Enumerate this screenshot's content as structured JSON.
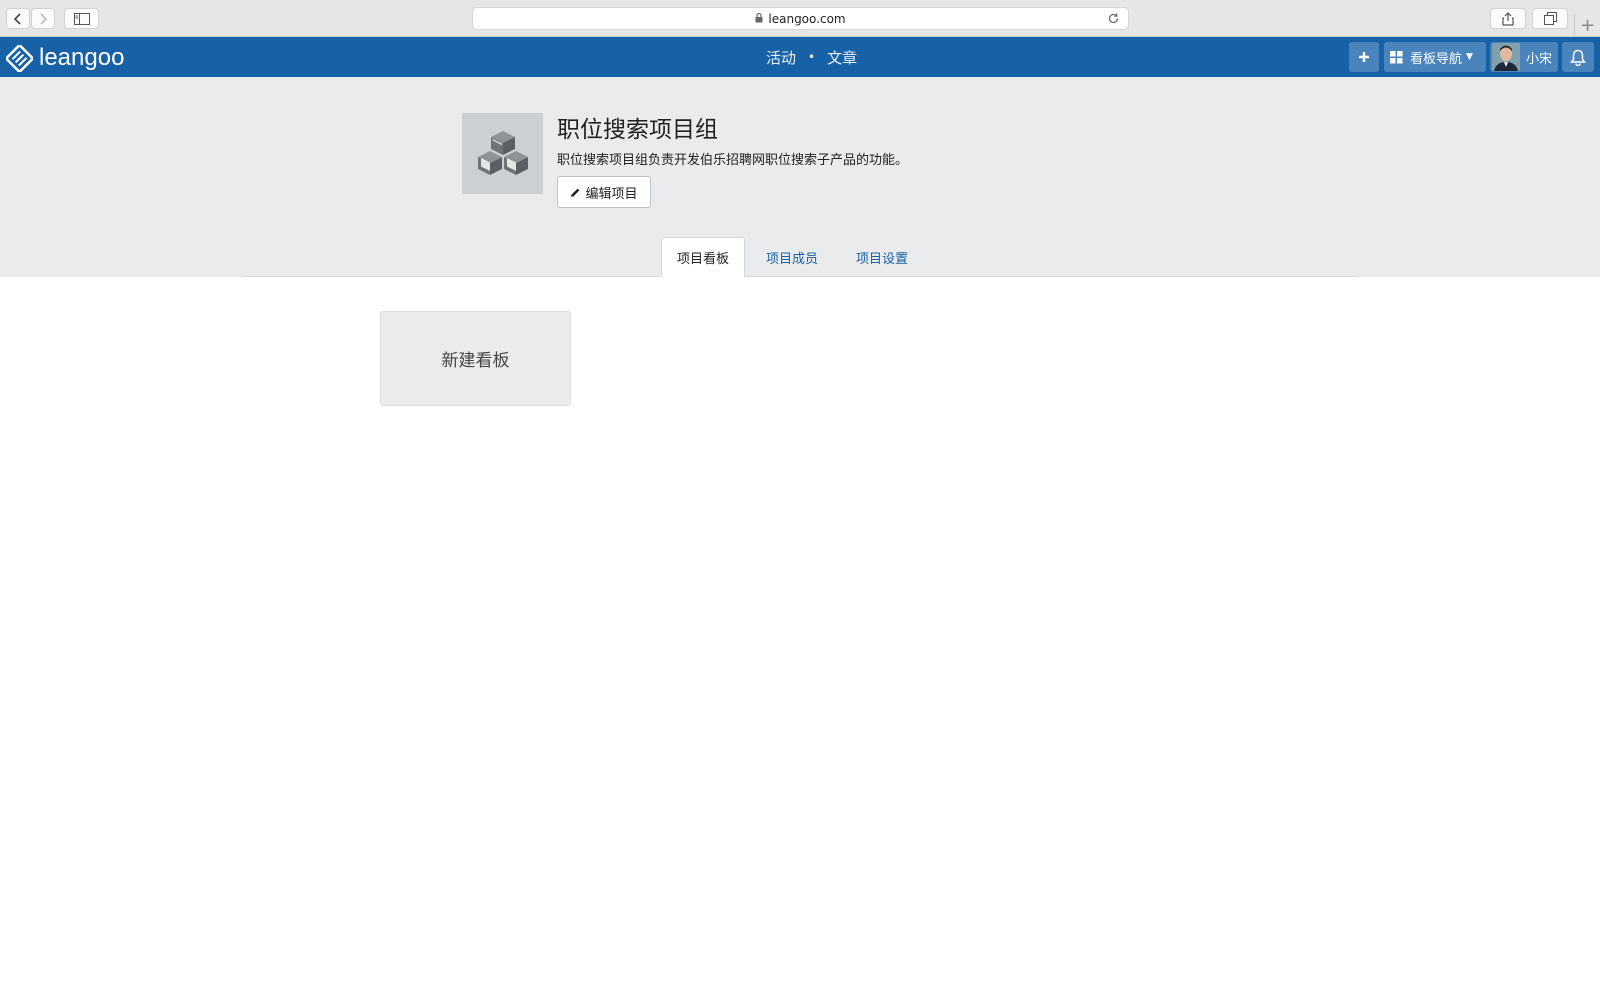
{
  "browser": {
    "url": "leangoo.com"
  },
  "header": {
    "logo_text": "leangoo",
    "nav": {
      "activity": "活动",
      "separator": "•",
      "articles": "文章"
    },
    "board_nav_label": "看板导航",
    "user_name": "小宋",
    "accent_color": "#1762a6"
  },
  "project": {
    "title": "职位搜索项目组",
    "description": "职位搜索项目组负责开发伯乐招聘网职位搜索子产品的功能。",
    "edit_label": "编辑项目"
  },
  "tabs": [
    {
      "label": "项目看板",
      "active": true
    },
    {
      "label": "项目成员",
      "active": false
    },
    {
      "label": "项目设置",
      "active": false
    }
  ],
  "boards": {
    "new_board_label": "新建看板"
  },
  "icons": {
    "back": "chevron-left-icon",
    "forward": "chevron-right-icon",
    "sidebar": "sidebar-icon",
    "share": "share-icon",
    "tabs": "tabs-overview-icon",
    "lock": "lock-icon",
    "reload": "reload-icon",
    "add": "plus-icon",
    "grid": "grid-icon",
    "bell": "bell-icon",
    "edit": "pencil-icon",
    "project": "cubes-icon"
  }
}
